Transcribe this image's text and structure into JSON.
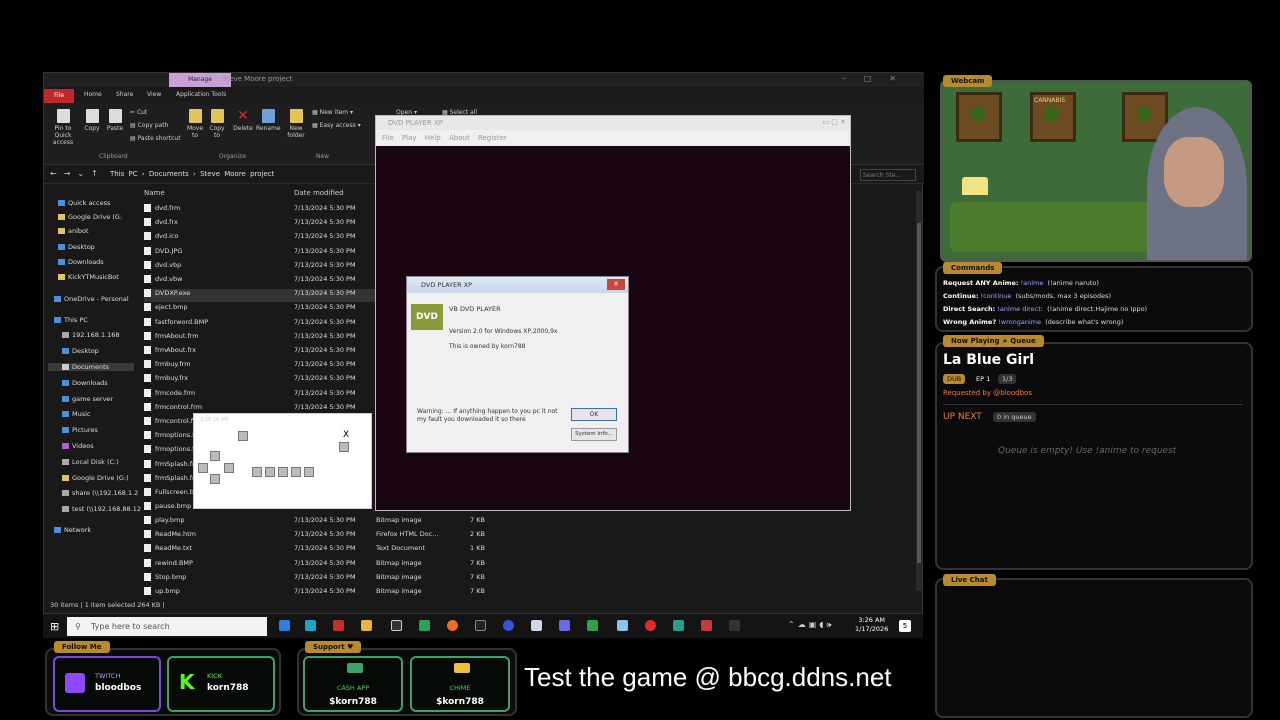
{
  "explorer": {
    "title": "Steve Moore project",
    "manage_tab": "Manage",
    "tabs": [
      "File",
      "Home",
      "Share",
      "View",
      "Application Tools"
    ],
    "ribbon": {
      "pin": "Pin to Quick access",
      "copy": "Copy",
      "paste": "Paste",
      "cut": "Cut",
      "copy_path": "Copy path",
      "paste_shortcut": "Paste shortcut",
      "move_to": "Move to",
      "copy_to": "Copy to",
      "delete": "Delete",
      "rename": "Rename",
      "new_folder": "New folder",
      "new_item": "New item",
      "easy_access": "Easy access",
      "open": "Open",
      "select_all": "Select all",
      "group_clipboard": "Clipboard",
      "group_organize": "Organize",
      "group_new": "New"
    },
    "breadcrumb": [
      "This PC",
      "Documents",
      "Steve Moore project"
    ],
    "search_placeholder": "Search Ste...",
    "sidebar": [
      "Quick access",
      "Google Drive (G:",
      "anibot",
      "Desktop",
      "Downloads",
      "KickYTMusicBot",
      "OneDrive - Personal",
      "This PC",
      "192.168.1.168",
      "Desktop",
      "Documents",
      "Downloads",
      "game server",
      "Music",
      "Pictures",
      "Videos",
      "Local Disk (C:)",
      "Google Drive (G:)",
      "share (\\\\192.168.1.2",
      "test (\\\\192.168.88.12",
      "Network"
    ],
    "columns": {
      "name": "Name",
      "date": "Date modified"
    },
    "files_top": [
      {
        "name": "dvd.frm",
        "date": "7/13/2024 5:30 PM"
      },
      {
        "name": "dvd.frx",
        "date": "7/13/2024 5:30 PM"
      },
      {
        "name": "dvd.ico",
        "date": "7/13/2024 5:30 PM"
      },
      {
        "name": "DVD.JPG",
        "date": "7/13/2024 5:30 PM"
      },
      {
        "name": "dvd.vbp",
        "date": "7/13/2024 5:30 PM"
      },
      {
        "name": "dvd.vbw",
        "date": "7/13/2024 5:30 PM"
      },
      {
        "name": "DVDXP.exe",
        "date": "7/13/2024 5:30 PM"
      },
      {
        "name": "eject.bmp",
        "date": "7/13/2024 5:30 PM"
      },
      {
        "name": "fastforword.BMP",
        "date": "7/13/2024 5:30 PM"
      },
      {
        "name": "frmAbout.frm",
        "date": "7/13/2024 5:30 PM"
      },
      {
        "name": "frmAbout.frx",
        "date": "7/13/2024 5:30 PM"
      },
      {
        "name": "frmbuy.frm",
        "date": "7/13/2024 5:30 PM"
      },
      {
        "name": "frmbuy.frx",
        "date": "7/13/2024 5:30 PM"
      },
      {
        "name": "frmcode.frm",
        "date": "7/13/2024 5:30 PM"
      },
      {
        "name": "frmcontrol.frm",
        "date": "7/13/2024 5:30 PM"
      },
      {
        "name": "frmcontrol.fr",
        "date": ""
      },
      {
        "name": "frmoptions.f",
        "date": ""
      },
      {
        "name": "frmoptions.f",
        "date": ""
      },
      {
        "name": "frmSplash.fr",
        "date": ""
      },
      {
        "name": "frmSplash.fr",
        "date": ""
      },
      {
        "name": "Fullscreen.b",
        "date": ""
      },
      {
        "name": "pause.bmp",
        "date": ""
      }
    ],
    "files_bottom": [
      {
        "name": "play.bmp",
        "date": "7/13/2024 5:30 PM",
        "type": "Bitmap image",
        "size": "7 KB"
      },
      {
        "name": "ReadMe.htm",
        "date": "7/13/2024 5:30 PM",
        "type": "Firefox HTML Doc...",
        "size": "2 KB"
      },
      {
        "name": "ReadMe.txt",
        "date": "7/13/2024 5:30 PM",
        "type": "Text Document",
        "size": "1 KB"
      },
      {
        "name": "rewind.BMP",
        "date": "7/13/2024 5:30 PM",
        "type": "Bitmap image",
        "size": "7 KB"
      },
      {
        "name": "Stop.bmp",
        "date": "7/13/2024 5:30 PM",
        "type": "Bitmap image",
        "size": "7 KB"
      },
      {
        "name": "up.bmp",
        "date": "7/13/2024 5:30 PM",
        "type": "Bitmap image",
        "size": "7 KB"
      }
    ],
    "status": "30 items  |  1 item selected  264 KB  |"
  },
  "dvd_window": {
    "title": "DVD PLAYER XP",
    "menu": [
      "File",
      "Play",
      "Help",
      "About",
      "Register"
    ]
  },
  "about_dialog": {
    "title": "DVD PLAYER XP",
    "logo": "DVD",
    "product": "VB DVD PLAYER",
    "version": "Version 2.0 for Windows XP,2000,9x",
    "owner": "This is owned by korn788",
    "warning": "Warning: ... If anything happen to you pc it not my fault you downloaded it so there",
    "ok": "OK",
    "sysinfo": "System Info..."
  },
  "control_form": {
    "title": "3:26:10 AM",
    "close": "X"
  },
  "taskbar": {
    "search_placeholder": "Type here to search",
    "time": "3:26 AM",
    "date": "1/17/2026",
    "notif_count": "5"
  },
  "overlay": {
    "webcam_label": "Webcam",
    "poster_text": "CANNABIS",
    "commands_label": "Commands",
    "commands": [
      {
        "label": "Request ANY Anime:",
        "cmd": "!anime",
        "desc": "(!anime naruto)"
      },
      {
        "label": "Continue:",
        "cmd": "!continue",
        "desc": "(subs/mods, max 3 episodes)"
      },
      {
        "label": "Direct Search:",
        "cmd": "!anime direct:",
        "desc": "(!anime direct:Hajime no Ippo)"
      },
      {
        "label": "Wrong Anime?",
        "cmd": "!wronganime",
        "desc": "(describe what's wrong)"
      }
    ],
    "now_playing_label": "Now Playing + Queue",
    "anime_title": "La Blue Girl",
    "dub": "DUB",
    "episode": "EP 1",
    "episode_count": "1/3",
    "requested_by": "Requested by @bloodbos",
    "up_next": "UP NEXT",
    "queue_count": "0 in queue",
    "queue_empty": "Queue is empty! Use !anime to request",
    "live_chat_label": "Live Chat",
    "follow_label": "Follow Me",
    "twitch_label": "TWITCH",
    "twitch_user": "bloodbos",
    "kick_label": "KICK",
    "kick_user": "korn788",
    "support_label": "Support ♥",
    "cashapp_label": "CASH APP",
    "cashapp_user": "$korn788",
    "chime_label": "CHIME",
    "chime_user": "$korn788",
    "big_text": "Test the game @ bbcg.ddns.net"
  },
  "colors": {
    "accent": "#b88a2b",
    "file_tab": "#c0282a",
    "manage_tab": "#c89fd6",
    "kick": "#53fc18",
    "twitch": "#9146ff"
  }
}
